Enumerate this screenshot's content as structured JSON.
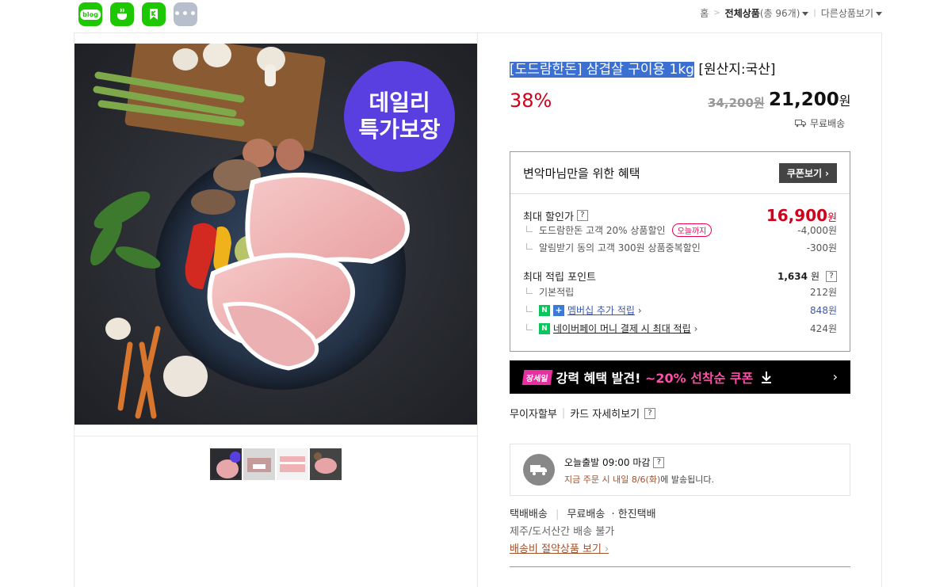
{
  "share": {
    "blog_label": "blog",
    "icons": [
      "blog-icon",
      "cafe-icon",
      "kakaostory-icon",
      "more-icon"
    ]
  },
  "topnav": {
    "home": "홈",
    "category": "전체상품",
    "count": "(총 96개)",
    "other": "다른상품보기"
  },
  "product": {
    "title_highlight": "[도드람한돈] 삼겹살 구이용 1kg",
    "title_rest": " [원산지:국산]",
    "discount": "38%",
    "original_price": "34,200원",
    "price": "21,200",
    "price_unit": "원",
    "shipping": "무료배송",
    "image_badge_line1": "데일리",
    "image_badge_line2": "특가보장"
  },
  "benefit": {
    "title": "변악마님만을 위한 혜택",
    "coupon_button": "쿠폰보기",
    "max_discount_label": "최대 할인가",
    "max_discount_value": "16,900",
    "won": "원",
    "discount_items": [
      {
        "label": "도드람한돈 고객 20% 상품할인",
        "badge": "오늘까지",
        "value": "-4,000원"
      },
      {
        "label": "알림받기 동의 고객 300원 상품중복할인",
        "value": "-300원"
      }
    ],
    "points_label": "최대 적립 포인트",
    "points_value": "1,634",
    "points_items": [
      {
        "label": "기본적립",
        "value": "212원"
      },
      {
        "label": "멤버십 추가 적립",
        "value": "848원"
      },
      {
        "label": "네이버페이 머니 결제 시 최대 적립",
        "value": "424원"
      }
    ]
  },
  "banner": {
    "tag": "장세일",
    "text": "강력 혜택 발견! ",
    "highlight": "~20% 선착순 쿠폰"
  },
  "card": {
    "installment": "무이자할부",
    "detail": "카드 자세히보기"
  },
  "delivery": {
    "title": "오늘출발 09:00 마감",
    "desc_prefix": "지금 주문 시 ",
    "desc_date": "내일 8/6(화)",
    "desc_suffix": "에 발송됩니다."
  },
  "shipping_info": {
    "method": "택배배송",
    "fee": "무료배송",
    "carrier": "· 한진택배",
    "restriction": "제주/도서산간 배송 불가",
    "link": "배송비 절약상품 보기"
  },
  "colors": {
    "discount_red": "#d0021b",
    "highlight_blue": "#3b6fd1",
    "naver_green": "#03c75a",
    "badge_purple": "#5a3fe0"
  }
}
